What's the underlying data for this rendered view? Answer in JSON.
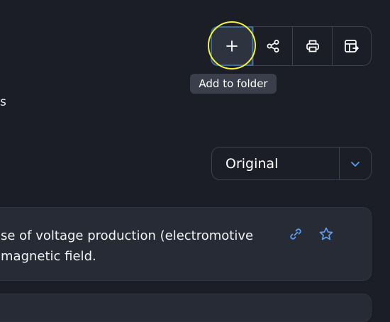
{
  "toolbar": {
    "buttons": [
      {
        "name": "add-to-folder",
        "icon": "plus-icon"
      },
      {
        "name": "share",
        "icon": "share-icon"
      },
      {
        "name": "print",
        "icon": "printer-icon"
      },
      {
        "name": "export",
        "icon": "table-export-icon"
      }
    ]
  },
  "tooltip": {
    "text": "Add to folder"
  },
  "partial_label": "s",
  "view_select": {
    "value": "Original"
  },
  "definition_card": {
    "line1": "se of voltage production (electromotive",
    "line2": "magnetic field."
  },
  "colors": {
    "background": "#1b1e27",
    "accent": "#5a9ef0",
    "highlight": "#f2f23a"
  }
}
